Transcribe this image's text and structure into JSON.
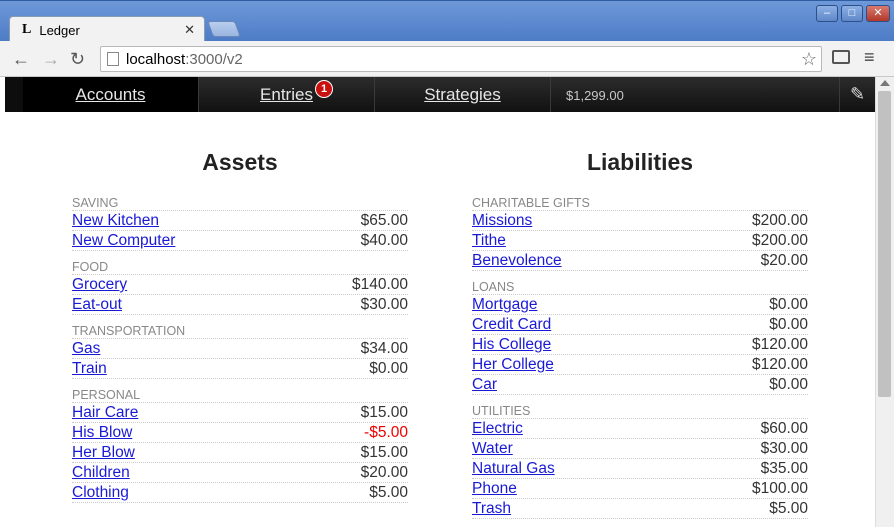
{
  "browser": {
    "tab_title": "Ledger",
    "tab_favicon": "L",
    "url_host": "localhost",
    "url_rest": ":3000/v2"
  },
  "nav": {
    "tabs": [
      {
        "label": "Accounts"
      },
      {
        "label": "Entries",
        "badge": "1"
      },
      {
        "label": "Strategies"
      }
    ],
    "balance": "$1,299.00"
  },
  "assets": {
    "title": "Assets",
    "groups": [
      {
        "label": "SAVING",
        "rows": [
          {
            "name": "New Kitchen",
            "amount": "$65.00"
          },
          {
            "name": "New Computer",
            "amount": "$40.00"
          }
        ]
      },
      {
        "label": "FOOD",
        "rows": [
          {
            "name": "Grocery",
            "amount": "$140.00"
          },
          {
            "name": "Eat-out",
            "amount": "$30.00"
          }
        ]
      },
      {
        "label": "TRANSPORTATION",
        "rows": [
          {
            "name": "Gas",
            "amount": "$34.00"
          },
          {
            "name": "Train",
            "amount": "$0.00"
          }
        ]
      },
      {
        "label": "PERSONAL",
        "rows": [
          {
            "name": "Hair Care",
            "amount": "$15.00"
          },
          {
            "name": "His Blow",
            "amount": "-$5.00",
            "negative": true
          },
          {
            "name": "Her Blow",
            "amount": "$15.00"
          },
          {
            "name": "Children",
            "amount": "$20.00"
          },
          {
            "name": "Clothing",
            "amount": "$5.00"
          }
        ]
      }
    ]
  },
  "liabilities": {
    "title": "Liabilities",
    "groups": [
      {
        "label": "CHARITABLE GIFTS",
        "rows": [
          {
            "name": "Missions",
            "amount": "$200.00"
          },
          {
            "name": "Tithe",
            "amount": "$200.00"
          },
          {
            "name": "Benevolence",
            "amount": "$20.00"
          }
        ]
      },
      {
        "label": "LOANS",
        "rows": [
          {
            "name": "Mortgage",
            "amount": "$0.00"
          },
          {
            "name": "Credit Card",
            "amount": "$0.00"
          },
          {
            "name": "His College",
            "amount": "$120.00"
          },
          {
            "name": "Her College",
            "amount": "$120.00"
          },
          {
            "name": "Car",
            "amount": "$0.00"
          }
        ]
      },
      {
        "label": "UTILITIES",
        "rows": [
          {
            "name": "Electric",
            "amount": "$60.00"
          },
          {
            "name": "Water",
            "amount": "$30.00"
          },
          {
            "name": "Natural Gas",
            "amount": "$35.00"
          },
          {
            "name": "Phone",
            "amount": "$100.00"
          },
          {
            "name": "Trash",
            "amount": "$5.00"
          }
        ]
      }
    ]
  },
  "colors": {
    "link": "#1a1ad6",
    "negative": "#ee0000",
    "badge": "#c9120f"
  }
}
